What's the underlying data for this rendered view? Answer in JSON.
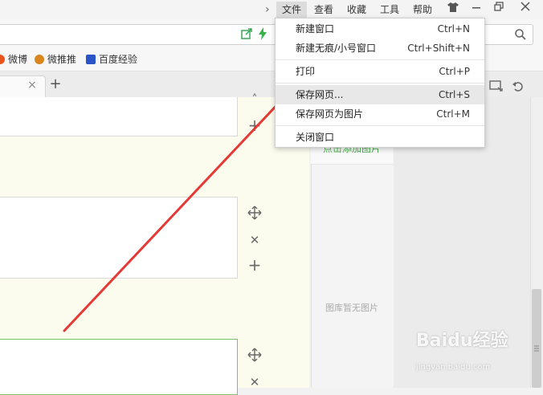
{
  "menubar": {
    "chevron": "›",
    "items": [
      "文件",
      "查看",
      "收藏",
      "工具",
      "帮助"
    ],
    "active_index": 0
  },
  "window_controls": [
    "shirt-icon",
    "minimize-icon",
    "restore-icon",
    "close-icon"
  ],
  "address_bar": {
    "search_icon": "search-icon"
  },
  "bookmarks": [
    {
      "label": "微博",
      "icon": "weibo-icon",
      "color": "#e8541e"
    },
    {
      "label": "微推推",
      "icon": "weituitui-icon",
      "color": "#d9861f"
    },
    {
      "label": "百度经验",
      "icon": "baidu-paw-icon",
      "color": "#2a55c9"
    }
  ],
  "tabs": {
    "close_glyph": "×",
    "new_tab_glyph": "+"
  },
  "dropdown": {
    "items": [
      {
        "label": "新建窗口",
        "shortcut": "Ctrl+N"
      },
      {
        "label": "新建无痕/小号窗口",
        "shortcut": "Ctrl+Shift+N"
      },
      {
        "label": "打印",
        "shortcut": "Ctrl+P"
      },
      {
        "label": "保存网页...",
        "shortcut": "Ctrl+S"
      },
      {
        "label": "保存网页为图片",
        "shortcut": "Ctrl+M"
      },
      {
        "label": "关闭窗口",
        "shortcut": ""
      }
    ],
    "hover_index": 3
  },
  "gallery": {
    "tab_label": "点击添加图片",
    "empty_text": "图库暂无图片"
  },
  "watermark": {
    "logo": "Baidu经验",
    "url": "jingyan.baidu.com"
  },
  "colors": {
    "arrow": "#e53935",
    "editor_bg": "#fbfbee",
    "gallery_tab_text": "#4caf50"
  }
}
